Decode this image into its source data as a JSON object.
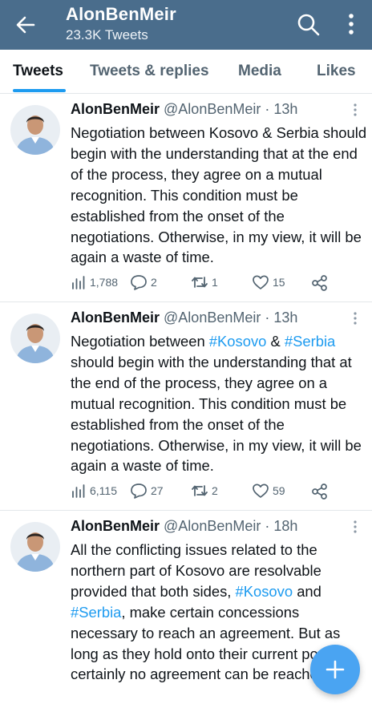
{
  "header": {
    "title": "AlonBenMeir",
    "subtitle": "23.3K Tweets"
  },
  "tabs": [
    {
      "label": "Tweets"
    },
    {
      "label": "Tweets & replies"
    },
    {
      "label": "Media"
    },
    {
      "label": "Likes"
    }
  ],
  "tweets": [
    {
      "name": "AlonBenMeir",
      "meta": "@AlonBenMeir · 13h",
      "text": "Negotiation between Kosovo & Serbia should begin with the understanding that at the end of the process, they agree on a mutual recognition. This condition must be established from the onset of the negotiations. Otherwise, in my view, it will be again a waste of time.",
      "views": "1,788",
      "replies": "2",
      "retweets": "1",
      "likes": "15"
    },
    {
      "name": "AlonBenMeir",
      "meta": "@AlonBenMeir · 13h",
      "text_parts": {
        "p1": "Negotiation between ",
        "h1": "#Kosovo",
        "p2": " & ",
        "h2": "#Serbia",
        "p3": " should begin with the understanding that at the end of the process, they agree on a mutual recognition. This condition must be established from the onset of the negotiations. Otherwise, in my view, it will be again a waste of time."
      },
      "views": "6,115",
      "replies": "27",
      "retweets": "2",
      "likes": "59"
    },
    {
      "name": "AlonBenMeir",
      "meta": "@AlonBenMeir · 18h",
      "text_parts": {
        "p1": "All the conflicting issues related to the northern part of Kosovo are resolvable provided that both sides, ",
        "h1": "#Kosovo",
        "p2": " and ",
        "h2": "#Serbia",
        "p3": ", make certain concessions necessary to reach an agreement. But as long as they hold onto their current position, certainly no agreement can be reached."
      }
    }
  ],
  "colors": {
    "header_bg": "#4a6d8c",
    "accent": "#1d9bf0",
    "fab": "#4aa4f2"
  },
  "icons": [
    "back-arrow-icon",
    "search-icon",
    "more-vertical-icon",
    "views-icon",
    "reply-icon",
    "retweet-icon",
    "like-icon",
    "share-icon",
    "compose-plus-icon"
  ]
}
